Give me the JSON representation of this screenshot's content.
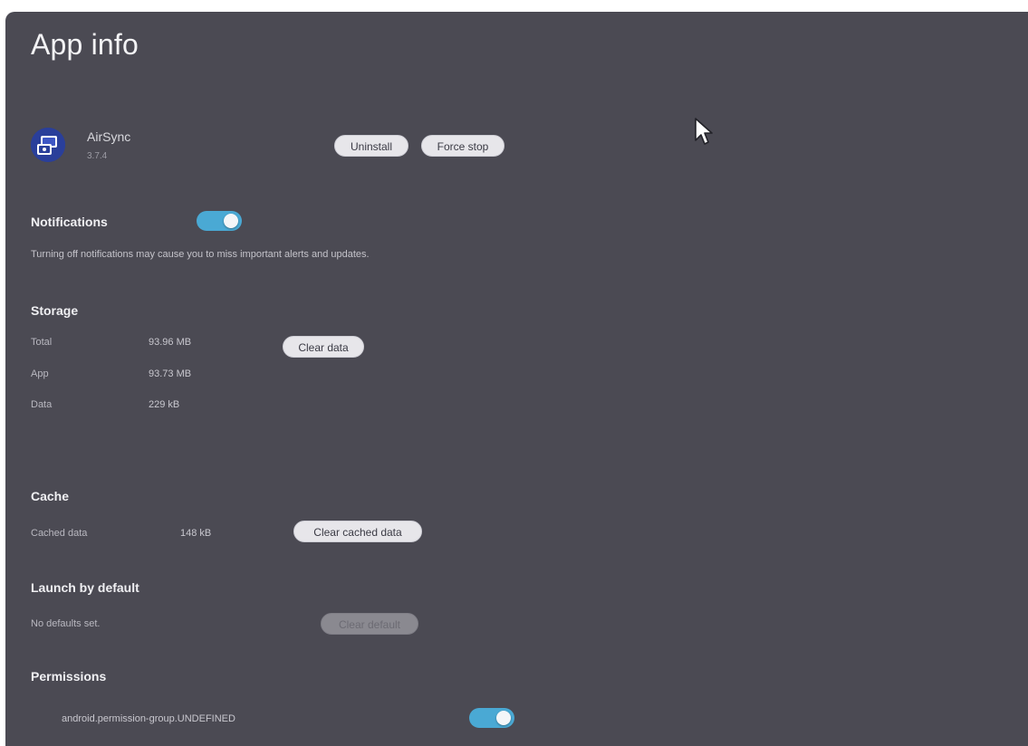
{
  "window": {
    "title": "App info"
  },
  "app": {
    "name": "AirSync",
    "version": "3.7.4",
    "icon": "airsync-app-icon",
    "icon_color": "#2a3f9a"
  },
  "actions": {
    "uninstall_label": "Uninstall",
    "force_stop_label": "Force stop"
  },
  "notifications": {
    "heading": "Notifications",
    "enabled": true,
    "description": "Turning off notifications may cause you to miss important alerts and updates."
  },
  "storage": {
    "heading": "Storage",
    "rows": [
      {
        "label": "Total",
        "value": "93.96 MB"
      },
      {
        "label": "App",
        "value": "93.73 MB"
      },
      {
        "label": "Data",
        "value": "229 kB"
      }
    ],
    "clear_data_label": "Clear data"
  },
  "cache": {
    "heading": "Cache",
    "label": "Cached data",
    "value": "148 kB",
    "clear_cache_label": "Clear cached data"
  },
  "launch_default": {
    "heading": "Launch by default",
    "description": "No defaults set.",
    "clear_default_label": "Clear default",
    "clear_default_enabled": false
  },
  "permissions": {
    "heading": "Permissions",
    "items": [
      {
        "label": "android.permission-group.UNDEFINED",
        "enabled": true
      }
    ]
  },
  "colors": {
    "panel_background": "#4b4a53",
    "toggle_on": "#4aa9d4",
    "button_background": "#e7e6ea"
  }
}
